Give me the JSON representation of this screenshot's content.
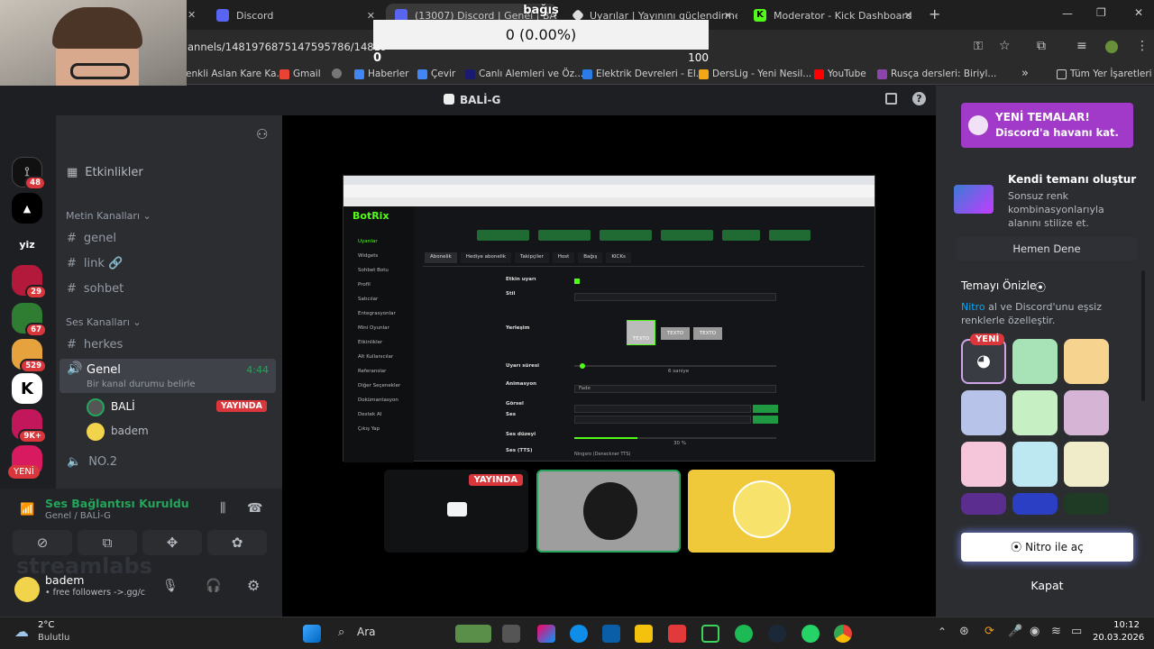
{
  "browser": {
    "tabs": [
      {
        "label": "Discord",
        "color": "#5865f2"
      },
      {
        "label": "(13007) Discord | Genel | BA",
        "color": "#5865f2"
      },
      {
        "label": "Uyarılar | Yayınını güçlendirmek",
        "color": "#dddddd"
      },
      {
        "label": "Moderator - Kick Dashboard",
        "color": "#53fc18"
      }
    ],
    "new_tab": "+",
    "url": "annels/1481976875147595786/14819",
    "bookmarks": [
      "enkli Aslan Kare Ka...",
      "Gmail",
      "Haberler",
      "Çevir",
      "Canlı Alemleri ve Öz...",
      "Elektrik Devreleri - El...",
      "DersLig - Yeni Nesil...",
      "YouTube",
      "Rusça dersleri: Biriyl..."
    ],
    "all_bookmarks": "Tüm Yer İşaretleri",
    "more": "»"
  },
  "overlay": {
    "goal_title": "bağış",
    "goal_value": "0 (0.00%)",
    "goal_min": "0",
    "goal_max": "100",
    "goal_progress": 0,
    "watermark": "streamlabs"
  },
  "discord": {
    "window_title": "BALİ-G",
    "guilds": [
      {
        "label": "",
        "badge": "48"
      },
      {
        "label": "",
        "badge": ""
      },
      {
        "label": "yiz",
        "badge": ""
      },
      {
        "label": "",
        "badge": "29"
      },
      {
        "label": "",
        "badge": "67"
      },
      {
        "label": "",
        "badge": "529"
      },
      {
        "label": "",
        "badge": ""
      },
      {
        "label": "",
        "badge": "9K+"
      },
      {
        "label": "",
        "badge": ""
      }
    ],
    "new_badge": "YENİ",
    "events": "Etkinlikler",
    "text_category": "Metin Kanalları",
    "text_channels": [
      "genel",
      "link 🔗",
      "sohbet"
    ],
    "voice_category": "Ses Kanalları",
    "voice_channels": {
      "herkes": "herkes",
      "genel": "Genel",
      "genel_time": "4:44",
      "status_hint": "Bir kanal durumu belirle",
      "no2": "NO.2"
    },
    "voice_users": [
      {
        "name": "BALİ",
        "live": "YAYINDA"
      },
      {
        "name": "badem",
        "live": ""
      }
    ],
    "connection": {
      "title": "Ses Bağlantısı Kuruldu",
      "subtitle": "Genel / BALİ-G"
    },
    "user": {
      "name": "badem",
      "status": "• free followers ->.gg/c"
    },
    "stage": {
      "live_label": "YAYINDA",
      "inner_app": "BotRix",
      "inner_tabs": [
        "Abonelik",
        "Hediye abonelik",
        "Takipçiler",
        "Host",
        "Bağış",
        "KICKs"
      ],
      "inner_menu": [
        "Uyarılar",
        "Widgets",
        "Sohbet Botu",
        "Profil",
        "Satıcılar",
        "Entegrasyonlar",
        "Mini Oyunlar",
        "Etkinlikler",
        "Alt Kullanıcılar",
        "Referanslar",
        "Diğer Seçenekler",
        "Dokümantasyon",
        "Destek AI",
        "Çıkış Yap"
      ],
      "inner_fields": [
        "Etkin uyarı",
        "Stil",
        "Yerleşim",
        "Uyarı süresi",
        "Animasyon",
        "Görsel",
        "Ses",
        "Ses düzeyi",
        "Ses (TTS)"
      ],
      "inner_values": {
        "layout": "TEXTO",
        "duration": "6 saniye",
        "animation": "Fade",
        "volume": "30 %",
        "tts": "Ningsro (Deneckner TTS)"
      }
    },
    "right": {
      "promo_title": "YENİ TEMALAR!",
      "promo_sub": "Discord'a havanı kat.",
      "own_title": "Kendi temanı oluştur",
      "own_desc": "Sonsuz renk kombinasyonlarıyla alanını stilize et.",
      "try_now": "Hemen Dene",
      "preview_title": "Temayı Önizle",
      "preview_desc_link": "Nitro",
      "preview_desc": " al ve Discord'unu eşsiz renklerle özelleştir.",
      "new_label": "YENİ",
      "nitro_button": "Nitro ile aç",
      "close": "Kapat",
      "swatches": [
        "#e8ccf2",
        "#a7e3b6",
        "#f6d48f",
        "#b7c3e8",
        "#c6f0c4",
        "#d6b4d6",
        "#f5c6d9",
        "#bde8f2",
        "#f0ecc9",
        "#5b2d8f",
        "#2b3fc4",
        "#1f3a25"
      ]
    }
  },
  "taskbar": {
    "weather_temp": "2°C",
    "weather_desc": "Bulutlu",
    "search": "Ara",
    "time": "10:12",
    "date": "20.03.2026"
  }
}
